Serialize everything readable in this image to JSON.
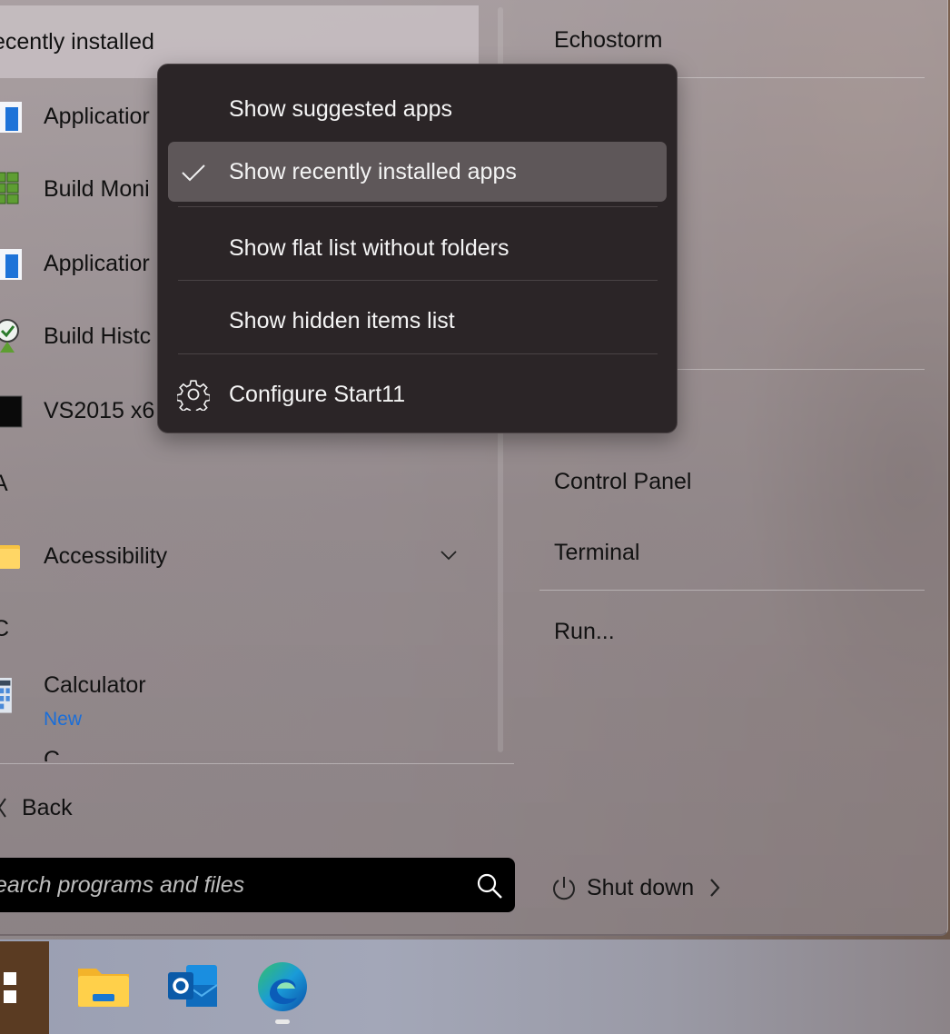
{
  "start_menu": {
    "section_title": "ecently installed",
    "apps": [
      {
        "label": "Applicatior",
        "icon": "application-window-icon"
      },
      {
        "label": "Build Moni",
        "icon": "build-monitor-icon"
      },
      {
        "label": "Applicatior",
        "icon": "application-window-icon"
      },
      {
        "label": "Build Histc",
        "icon": "build-history-icon"
      },
      {
        "label": "VS2015 x6",
        "icon": "console-icon"
      }
    ],
    "group_letters": [
      "A",
      "C"
    ],
    "accessibility": {
      "label": "Accessibility",
      "icon": "folder-icon"
    },
    "calculator": {
      "label": "Calculator",
      "badge": "New",
      "icon": "calculator-icon"
    },
    "partial_next": "C",
    "back_label": "Back",
    "search_placeholder": "earch programs and files"
  },
  "right_column": {
    "items": [
      "Echostorm",
      "Control Panel",
      "Terminal",
      "Run..."
    ],
    "shutdown_label": "Shut down"
  },
  "context_menu": {
    "items": [
      {
        "label": "Show suggested apps",
        "checked": false
      },
      {
        "label": "Show recently installed apps",
        "checked": true
      },
      {
        "label": "Show flat list without folders",
        "checked": false
      },
      {
        "label": "Show hidden items list",
        "checked": false
      },
      {
        "label": "Configure Start11",
        "icon": "gear-icon"
      }
    ]
  },
  "taskbar": {
    "icons": [
      "windows-start-icon",
      "file-explorer-icon",
      "outlook-icon",
      "edge-icon"
    ]
  },
  "colors": {
    "menu_bg": "#2b2527",
    "menu_selected": "#5e5759",
    "accent_new": "#1a6ed8"
  }
}
